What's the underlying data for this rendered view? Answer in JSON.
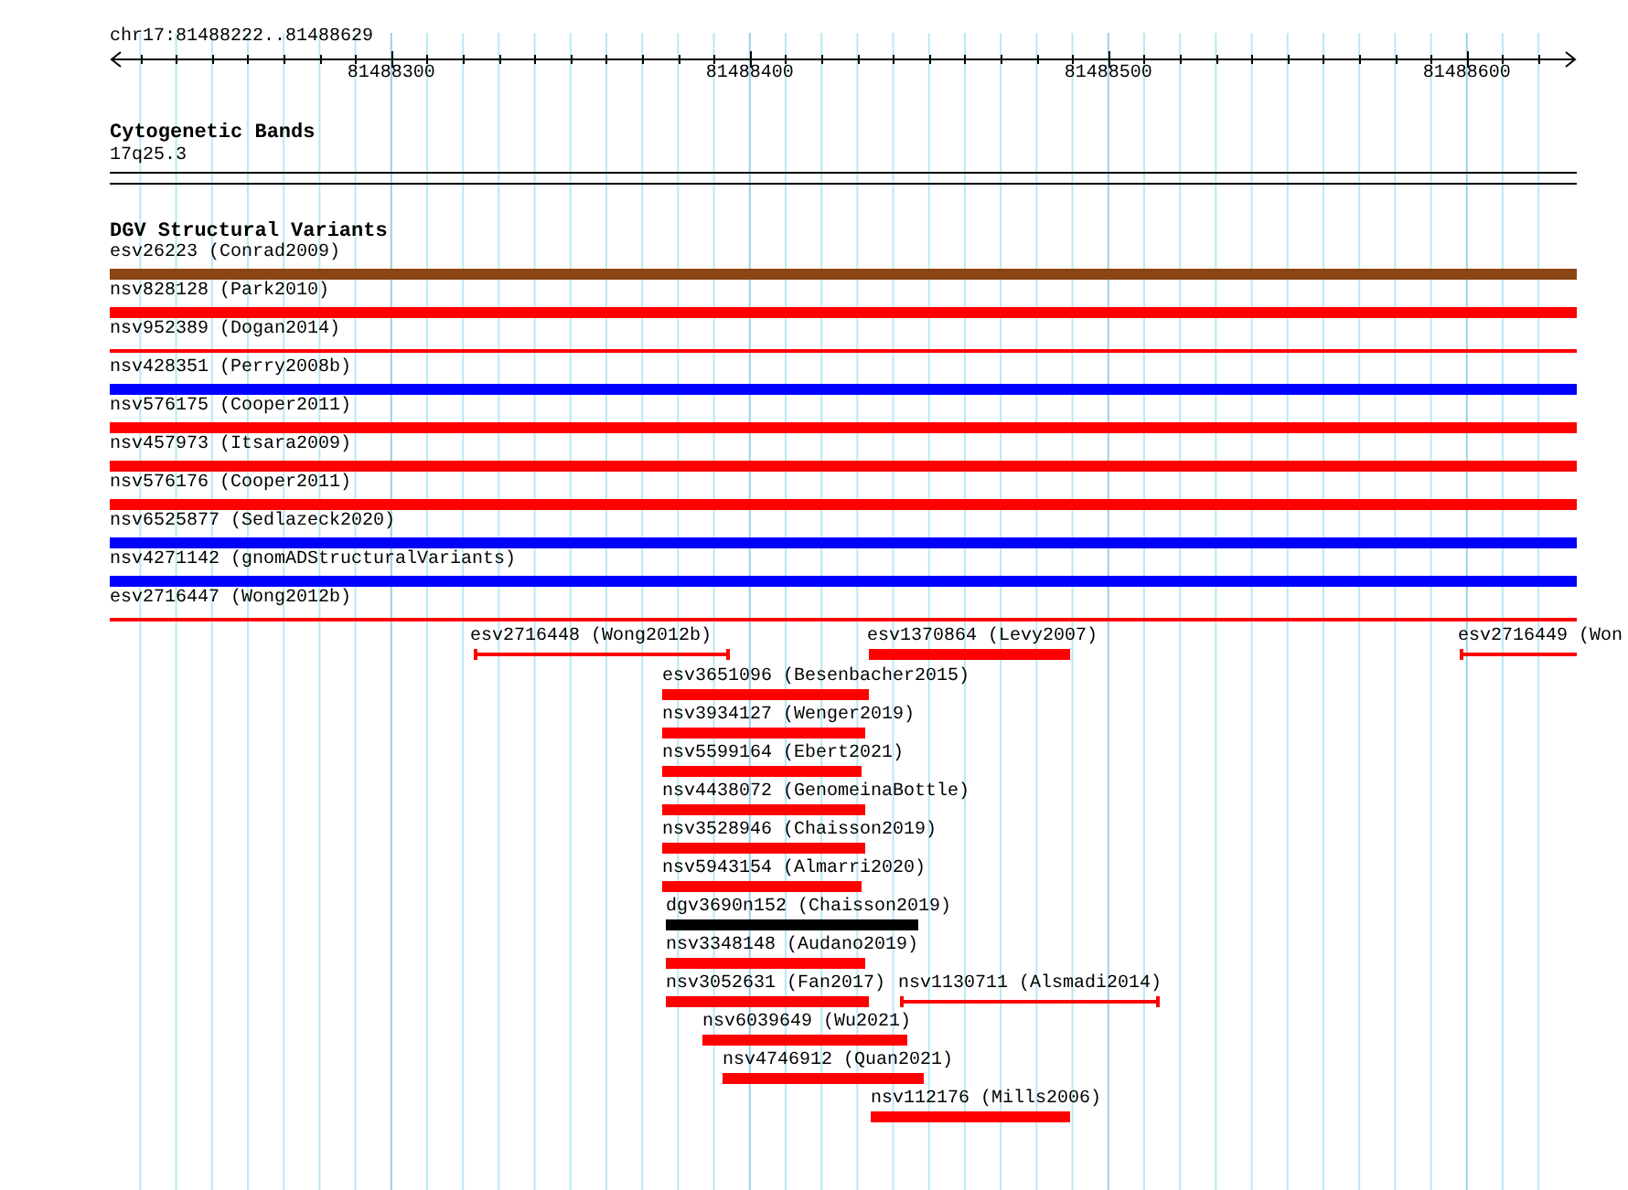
{
  "location": "chr17:81488222..81488629",
  "ruler": {
    "ticks": [
      "81488300",
      "81488400",
      "81488500",
      "81488600"
    ]
  },
  "cytogenetic_bands": {
    "title": "Cytogenetic Bands",
    "band": "17q25.3"
  },
  "dgv_track": {
    "title": "DGV Structural Variants",
    "full_span_features": [
      {
        "label": "esv26223 (Conrad2009)",
        "kind": "bar",
        "color": "#8b4513"
      },
      {
        "label": "nsv828128 (Park2010)",
        "kind": "bar",
        "color": "#ff0000"
      },
      {
        "label": "nsv952389 (Dogan2014)",
        "kind": "line",
        "color": "#ff0000"
      },
      {
        "label": "nsv428351 (Perry2008b)",
        "kind": "bar",
        "color": "#0000ff"
      },
      {
        "label": "nsv576175 (Cooper2011)",
        "kind": "bar",
        "color": "#ff0000"
      },
      {
        "label": "nsv457973 (Itsara2009)",
        "kind": "bar",
        "color": "#ff0000"
      },
      {
        "label": "nsv576176 (Cooper2011)",
        "kind": "bar",
        "color": "#ff0000"
      },
      {
        "label": "nsv6525877 (Sedlazeck2020)",
        "kind": "bar",
        "color": "#0000ff"
      },
      {
        "label": "nsv4271142 (gnomADStructuralVariants)",
        "kind": "bar",
        "color": "#0000ff"
      },
      {
        "label": "esv2716447 (Wong2012b)",
        "kind": "line",
        "color": "#ff0000"
      }
    ],
    "features": [
      {
        "label": "esv2716448 (Wong2012b)",
        "kind": "line",
        "color": "#ff0000"
      },
      {
        "label": "esv1370864 (Levy2007)",
        "kind": "bar",
        "color": "#ff0000"
      },
      {
        "label": "esv2716449 (Won",
        "kind": "line",
        "color": "#ff0000"
      },
      {
        "label": "esv3651096 (Besenbacher2015)",
        "kind": "bar",
        "color": "#ff0000"
      },
      {
        "label": "nsv3934127 (Wenger2019)",
        "kind": "bar",
        "color": "#ff0000"
      },
      {
        "label": "nsv5599164 (Ebert2021)",
        "kind": "bar",
        "color": "#ff0000"
      },
      {
        "label": "nsv4438072 (GenomeinaBottle)",
        "kind": "bar",
        "color": "#ff0000"
      },
      {
        "label": "nsv3528946 (Chaisson2019)",
        "kind": "bar",
        "color": "#ff0000"
      },
      {
        "label": "nsv5943154 (Almarri2020)",
        "kind": "bar",
        "color": "#ff0000"
      },
      {
        "label": "dgv3690n152 (Chaisson2019)",
        "kind": "bar",
        "color": "#000000"
      },
      {
        "label": "nsv3348148 (Audano2019)",
        "kind": "bar",
        "color": "#ff0000"
      },
      {
        "label": "nsv3052631 (Fan2017)",
        "kind": "bar",
        "color": "#ff0000"
      },
      {
        "label": "nsv1130711 (Alsmadi2014)",
        "kind": "line",
        "color": "#ff0000"
      },
      {
        "label": "nsv6039649 (Wu2021)",
        "kind": "bar",
        "color": "#ff0000"
      },
      {
        "label": "nsv4746912 (Quan2021)",
        "kind": "bar",
        "color": "#ff0000"
      },
      {
        "label": "nsv112176 (Mills2006)",
        "kind": "bar",
        "color": "#ff0000"
      }
    ]
  }
}
